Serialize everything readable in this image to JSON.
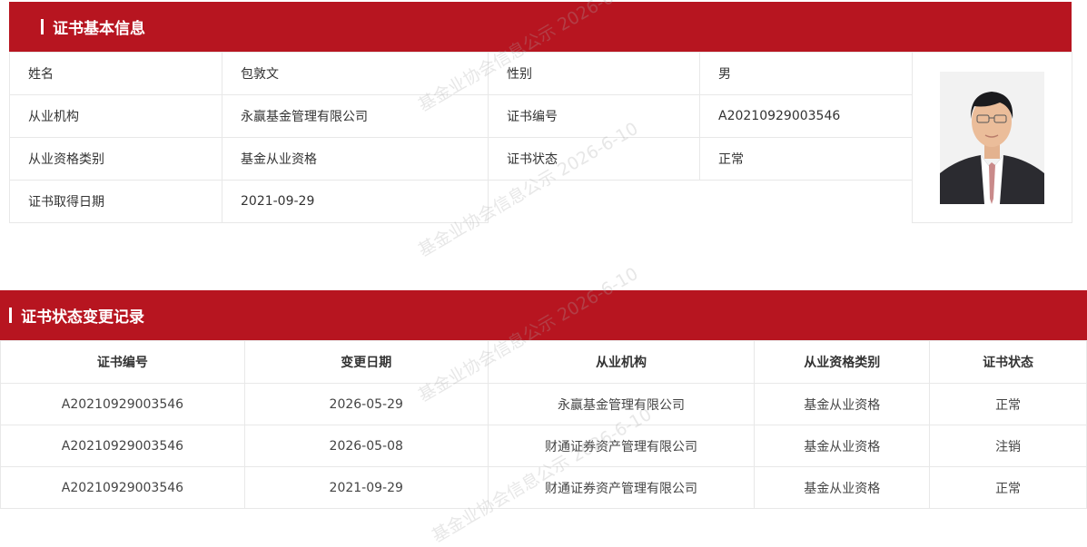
{
  "basic_info": {
    "title": "证书基本信息",
    "rows": [
      {
        "label1": "姓名",
        "value1": "包敦文",
        "label2": "性别",
        "value2": "男"
      },
      {
        "label1": "从业机构",
        "value1": "永赢基金管理有限公司",
        "label2": "证书编号",
        "value2": "A20210929003546"
      },
      {
        "label1": "从业资格类别",
        "value1": "基金从业资格",
        "label2": "证书状态",
        "value2": "正常"
      },
      {
        "label1": "证书取得日期",
        "value1": "2021-09-29"
      }
    ]
  },
  "history": {
    "title": "证书状态变更记录",
    "columns": [
      "证书编号",
      "变更日期",
      "从业机构",
      "从业资格类别",
      "证书状态"
    ],
    "rows": [
      [
        "A20210929003546",
        "2026-05-29",
        "永赢基金管理有限公司",
        "基金从业资格",
        "正常"
      ],
      [
        "A20210929003546",
        "2026-05-08",
        "财通证券资产管理有限公司",
        "基金从业资格",
        "注销"
      ],
      [
        "A20210929003546",
        "2021-09-29",
        "财通证券资产管理有限公司",
        "基金从业资格",
        "正常"
      ]
    ]
  },
  "watermark": "基金业协会信息公示 2026-6-10",
  "colors": {
    "accent": "#b71520",
    "border": "#e8e8e8"
  }
}
